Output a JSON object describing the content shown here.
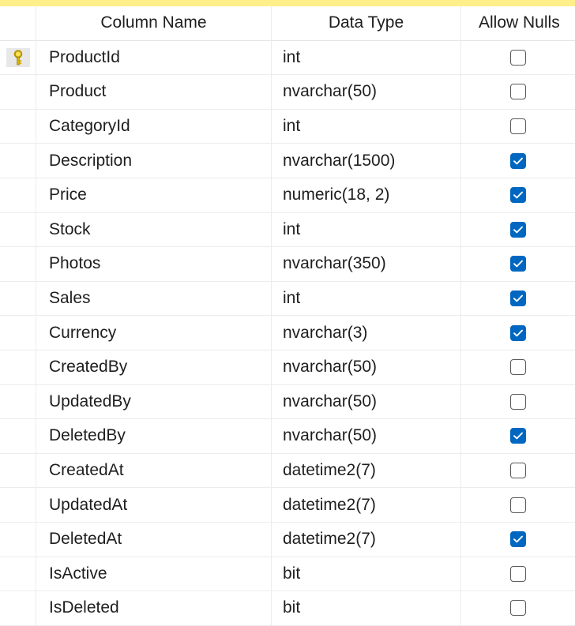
{
  "header": {
    "column_name": "Column Name",
    "data_type": "Data Type",
    "allow_nulls": "Allow Nulls"
  },
  "columns": [
    {
      "name": "ProductId",
      "type": "int",
      "allow_nulls": false,
      "primary_key": true
    },
    {
      "name": "Product",
      "type": "nvarchar(50)",
      "allow_nulls": false
    },
    {
      "name": "CategoryId",
      "type": "int",
      "allow_nulls": false
    },
    {
      "name": "Description",
      "type": "nvarchar(1500)",
      "allow_nulls": true
    },
    {
      "name": "Price",
      "type": "numeric(18, 2)",
      "allow_nulls": true
    },
    {
      "name": "Stock",
      "type": "int",
      "allow_nulls": true
    },
    {
      "name": "Photos",
      "type": "nvarchar(350)",
      "allow_nulls": true
    },
    {
      "name": "Sales",
      "type": "int",
      "allow_nulls": true
    },
    {
      "name": "Currency",
      "type": "nvarchar(3)",
      "allow_nulls": true
    },
    {
      "name": "CreatedBy",
      "type": "nvarchar(50)",
      "allow_nulls": false
    },
    {
      "name": "UpdatedBy",
      "type": "nvarchar(50)",
      "allow_nulls": false
    },
    {
      "name": "DeletedBy",
      "type": "nvarchar(50)",
      "allow_nulls": true
    },
    {
      "name": "CreatedAt",
      "type": "datetime2(7)",
      "allow_nulls": false
    },
    {
      "name": "UpdatedAt",
      "type": "datetime2(7)",
      "allow_nulls": false
    },
    {
      "name": "DeletedAt",
      "type": "datetime2(7)",
      "allow_nulls": true
    },
    {
      "name": "IsActive",
      "type": "bit",
      "allow_nulls": false
    },
    {
      "name": "IsDeleted",
      "type": "bit",
      "allow_nulls": false
    }
  ],
  "icons": {
    "primary_key": "key-icon",
    "checked": "checkmark-icon"
  },
  "colors": {
    "checkbox_checked": "#0067c0",
    "key": "#d4b000",
    "header_strip": "#ffef8a"
  }
}
